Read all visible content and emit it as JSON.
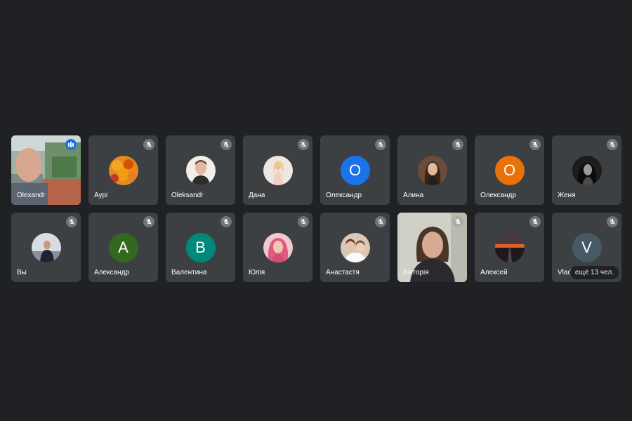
{
  "tiles": [
    {
      "name": "Olexandr",
      "video": true,
      "speaking": true
    },
    {
      "name": "Аурі",
      "avatar": "photo",
      "avatar_color": "#e8891f"
    },
    {
      "name": "Oleksandr",
      "avatar": "photo",
      "avatar_color": "#f1ede7"
    },
    {
      "name": "Дана",
      "avatar": "photo",
      "avatar_color": "#efe6e0"
    },
    {
      "name": "Олександр",
      "avatar": "letter",
      "letter": "О",
      "avatar_color": "#1a73e8"
    },
    {
      "name": "Алина",
      "avatar": "photo",
      "avatar_color": "#6b4b3a"
    },
    {
      "name": "Олександр",
      "avatar": "letter",
      "letter": "О",
      "avatar_color": "#e8710a"
    },
    {
      "name": "Женя",
      "avatar": "photo",
      "avatar_color": "#1c1c1c"
    },
    {
      "name": "Вы",
      "avatar": "photo",
      "avatar_color": "#d8dde3"
    },
    {
      "name": "Александр",
      "avatar": "letter",
      "letter": "А",
      "avatar_color": "#33691e"
    },
    {
      "name": "Валентина",
      "avatar": "letter",
      "letter": "В",
      "avatar_color": "#00897b"
    },
    {
      "name": "Юлія",
      "avatar": "photo",
      "avatar_color": "#e05a82"
    },
    {
      "name": "Анастастя",
      "avatar": "photo",
      "avatar_color": "#d9c7b8"
    },
    {
      "name": "Вікторія",
      "video": true
    },
    {
      "name": "Алексей",
      "avatar": "photo",
      "avatar_color": "#3a2a2a"
    },
    {
      "name": "Vlady",
      "avatar": "letter",
      "letter": "V",
      "avatar_color": "#455a64",
      "more": "ещё 13 чел."
    }
  ],
  "icons": {
    "muted": "mic-off-icon",
    "speaking": "audio-bars-icon"
  },
  "colors": {
    "background": "#202124",
    "tile": "#3c4043"
  }
}
